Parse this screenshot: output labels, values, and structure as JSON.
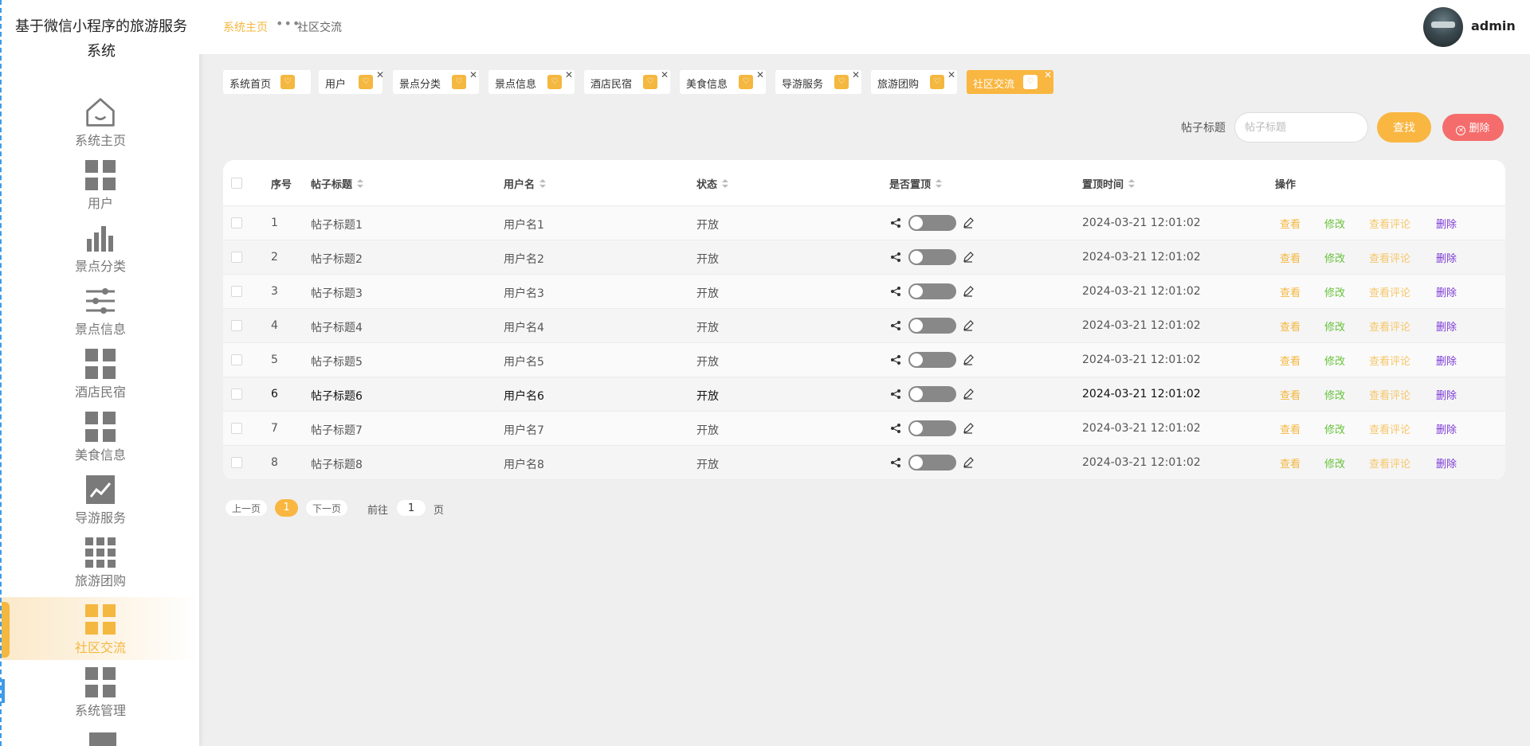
{
  "app": {
    "title": "基于微信小程序的旅游服务系统"
  },
  "sidebar": {
    "items": [
      {
        "label": "系统主页",
        "icon": "home-icon"
      },
      {
        "label": "用户",
        "icon": "grid-icon"
      },
      {
        "label": "景点分类",
        "icon": "bar-chart-icon"
      },
      {
        "label": "景点信息",
        "icon": "sliders-icon"
      },
      {
        "label": "酒店民宿",
        "icon": "grid-icon"
      },
      {
        "label": "美食信息",
        "icon": "grid-icon"
      },
      {
        "label": "导游服务",
        "icon": "trend-chart-icon"
      },
      {
        "label": "旅游团购",
        "icon": "grid-nine-icon"
      },
      {
        "label": "社区交流",
        "icon": "grid-icon",
        "active": true
      },
      {
        "label": "系统管理",
        "icon": "grid-icon"
      }
    ]
  },
  "header": {
    "breadcrumb_home": "系统主页",
    "breadcrumb_sep": "•••",
    "breadcrumb_current": "社区交流",
    "username": "admin"
  },
  "tags": [
    {
      "label": "系统首页"
    },
    {
      "label": "用户"
    },
    {
      "label": "景点分类"
    },
    {
      "label": "景点信息"
    },
    {
      "label": "酒店民宿"
    },
    {
      "label": "美食信息"
    },
    {
      "label": "导游服务"
    },
    {
      "label": "旅游团购"
    },
    {
      "label": "社区交流",
      "active": true
    }
  ],
  "search": {
    "label": "帖子标题",
    "placeholder": "帖子标题",
    "search_button": "查找",
    "delete_button": "删除"
  },
  "table": {
    "headers": [
      "序号",
      "帖子标题",
      "用户名",
      "状态",
      "是否置顶",
      "置顶时间",
      "操作"
    ],
    "rows": [
      {
        "index": "1",
        "title": "帖子标题1",
        "username": "用户名1",
        "status": "开放",
        "time": "2024-03-21 12:01:02"
      },
      {
        "index": "2",
        "title": "帖子标题2",
        "username": "用户名2",
        "status": "开放",
        "time": "2024-03-21 12:01:02"
      },
      {
        "index": "3",
        "title": "帖子标题3",
        "username": "用户名3",
        "status": "开放",
        "time": "2024-03-21 12:01:02"
      },
      {
        "index": "4",
        "title": "帖子标题4",
        "username": "用户名4",
        "status": "开放",
        "time": "2024-03-21 12:01:02"
      },
      {
        "index": "5",
        "title": "帖子标题5",
        "username": "用户名5",
        "status": "开放",
        "time": "2024-03-21 12:01:02"
      },
      {
        "index": "6",
        "title": "帖子标题6",
        "username": "用户名6",
        "status": "开放",
        "time": "2024-03-21 12:01:02"
      },
      {
        "index": "7",
        "title": "帖子标题7",
        "username": "用户名7",
        "status": "开放",
        "time": "2024-03-21 12:01:02"
      },
      {
        "index": "8",
        "title": "帖子标题8",
        "username": "用户名8",
        "status": "开放",
        "time": "2024-03-21 12:01:02"
      }
    ],
    "actions": {
      "view": "查看",
      "edit": "修改",
      "comments": "查看评论",
      "delete": "删除"
    }
  },
  "pagination": {
    "prev": "上一页",
    "current": "1",
    "next": "下一页",
    "goto_label": "前往",
    "goto_value": "1",
    "page_suffix": "页"
  },
  "colors": {
    "accent": "#f9b640",
    "danger": "#f56c6c",
    "success": "#67c23a",
    "purple": "#7c3ad6",
    "sidebar_border": "#3d9be9"
  }
}
